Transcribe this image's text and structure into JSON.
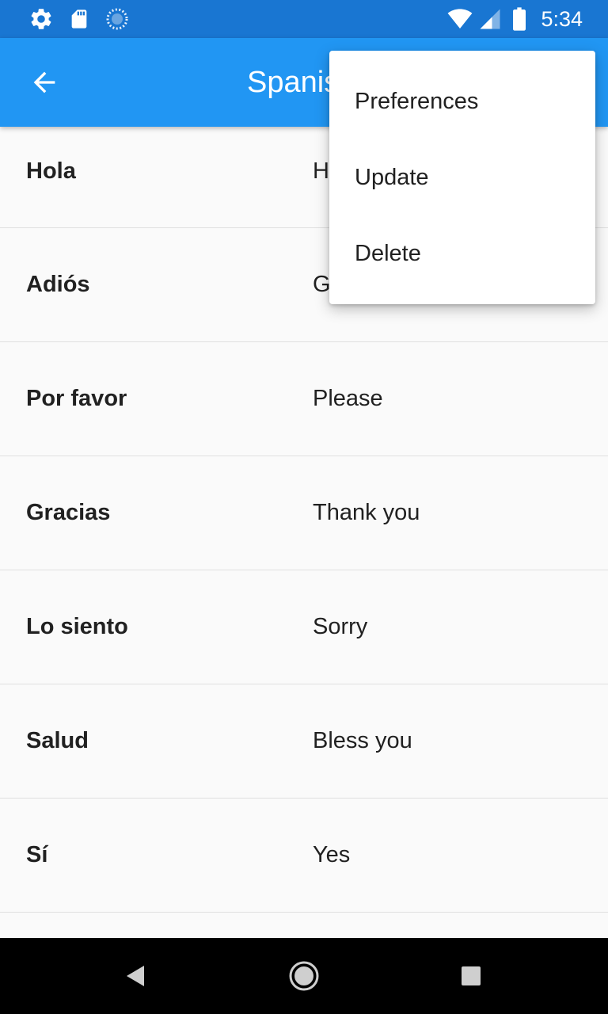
{
  "status_bar": {
    "time": "5:34",
    "icons": [
      "settings-icon",
      "sd-card-icon",
      "sync-icon",
      "wifi-icon",
      "signal-icon",
      "battery-icon"
    ]
  },
  "app_bar": {
    "title": "Spanish",
    "back_icon": "arrow-back-icon"
  },
  "rows": [
    {
      "term": "Hola",
      "meaning": "Hello"
    },
    {
      "term": "Adiós",
      "meaning": "Goodbye"
    },
    {
      "term": "Por favor",
      "meaning": "Please"
    },
    {
      "term": "Gracias",
      "meaning": "Thank you"
    },
    {
      "term": "Lo siento",
      "meaning": "Sorry"
    },
    {
      "term": "Salud",
      "meaning": "Bless you"
    },
    {
      "term": "Sí",
      "meaning": "Yes"
    },
    {
      "term": "",
      "meaning": ""
    }
  ],
  "menu": {
    "items": [
      {
        "label": "Preferences"
      },
      {
        "label": "Update"
      },
      {
        "label": "Delete"
      }
    ]
  },
  "nav_bar": {
    "icons": [
      "back-triangle-icon",
      "home-circle-icon",
      "recents-square-icon"
    ]
  },
  "colors": {
    "status_bar": "#1976d2",
    "app_bar": "#2196f3",
    "background": "#fafafa"
  }
}
